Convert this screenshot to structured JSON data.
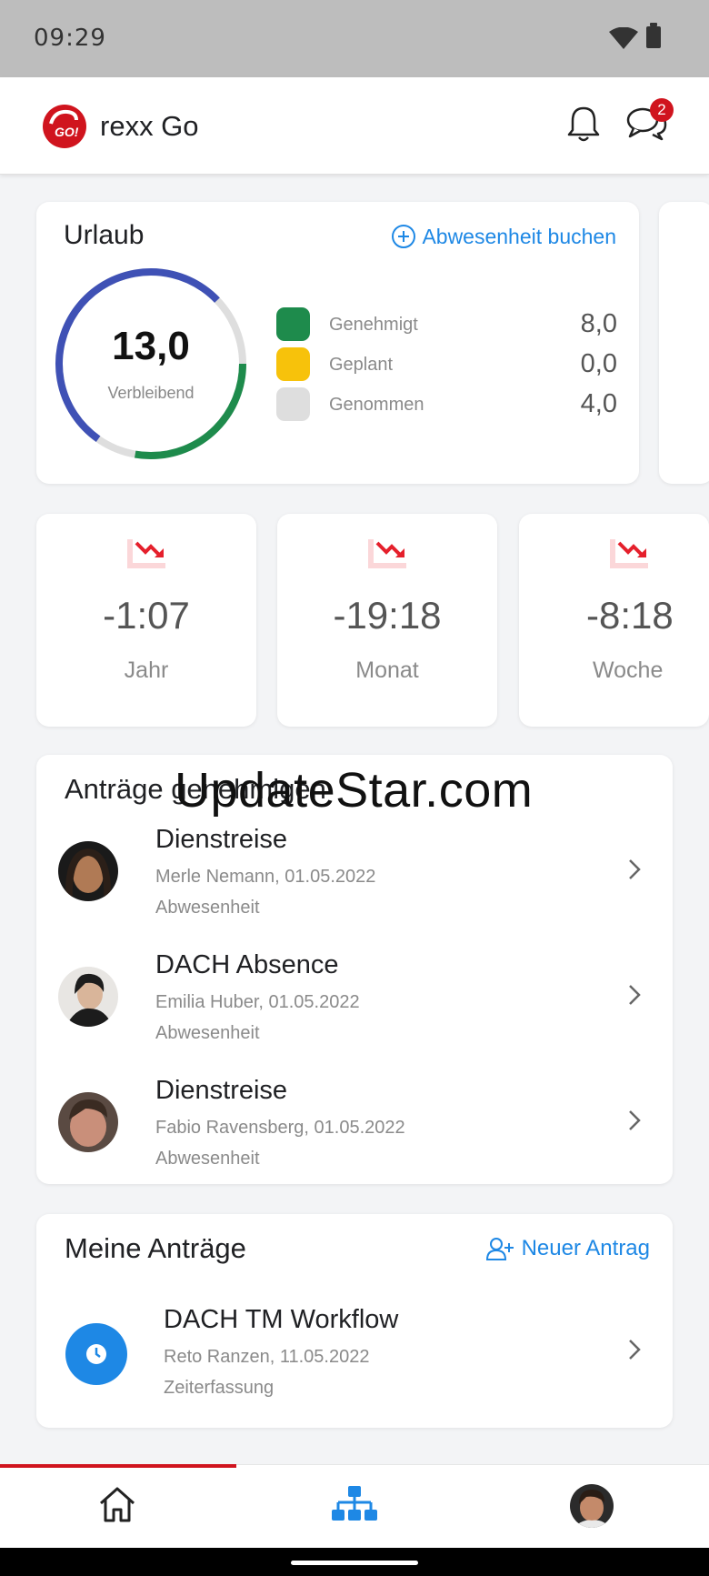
{
  "status_bar": {
    "time": "09:29"
  },
  "app_bar": {
    "title": "rexx Go",
    "chat_badge": "2",
    "logo_text": "GO!"
  },
  "vacation": {
    "title": "Urlaub",
    "book_label": "Abwesenheit buchen",
    "remaining_value": "13,0",
    "remaining_label": "Verbleibend",
    "legend": [
      {
        "label": "Genehmigt",
        "value": "8,0",
        "color": "#1e8b4c"
      },
      {
        "label": "Geplant",
        "value": "0,0",
        "color": "#f7c20b"
      },
      {
        "label": "Genommen",
        "value": "4,0",
        "color": "#dedede"
      }
    ],
    "ring_colors": {
      "remaining": "#3f51b5",
      "approved": "#1e8b4c",
      "taken": "#dedede"
    }
  },
  "time_stats": [
    {
      "value": "-1:07",
      "label": "Jahr"
    },
    {
      "value": "-19:18",
      "label": "Monat"
    },
    {
      "value": "-8:18",
      "label": "Woche"
    }
  ],
  "approvals": {
    "title": "Anträge genehmigen",
    "items": [
      {
        "title": "Dienstreise",
        "subtitle": "Merle Nemann, 01.05.2022",
        "type": "Abwesenheit"
      },
      {
        "title": "DACH Absence",
        "subtitle": "Emilia Huber, 01.05.2022",
        "type": "Abwesenheit"
      },
      {
        "title": "Dienstreise",
        "subtitle": "Fabio Ravensberg, 01.05.2022",
        "type": "Abwesenheit"
      }
    ]
  },
  "my_requests": {
    "title": "Meine Anträge",
    "new_label": "Neuer Antrag",
    "items": [
      {
        "title": "DACH TM Workflow",
        "subtitle": "Reto Ranzen, 11.05.2022",
        "type": "Zeiterfassung"
      }
    ]
  },
  "watermark": "UpdateStar.com",
  "colors": {
    "brand_red": "#d0141e",
    "accent_blue": "#1e88e5"
  }
}
